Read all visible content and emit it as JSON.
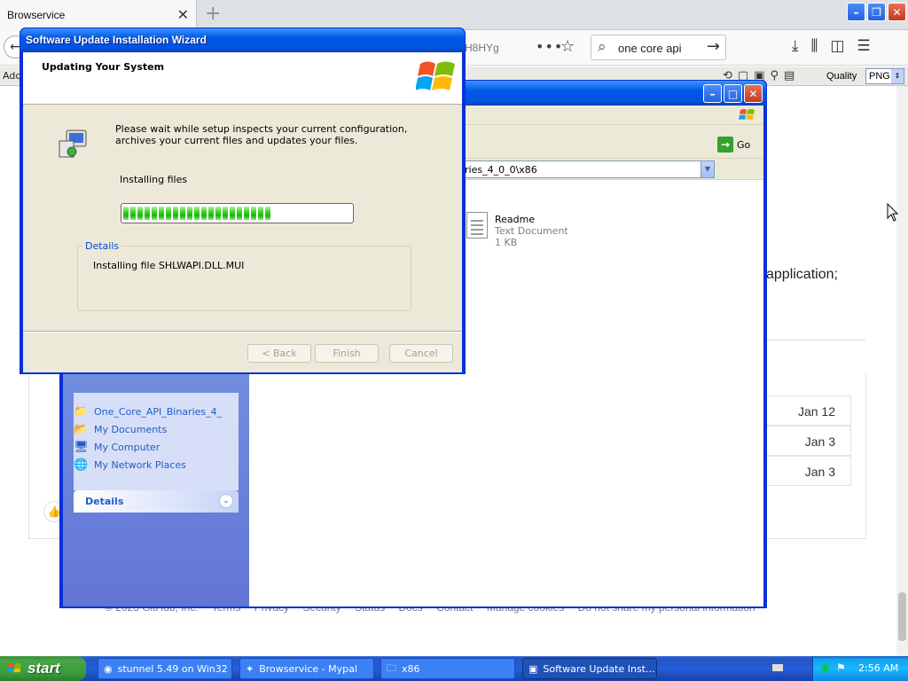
{
  "browser": {
    "tab_title": "Browservice",
    "url_fragment": "H8HYg",
    "search_text": "one core api",
    "addon_label": "Add",
    "quality_label": "Quality",
    "quality_value": "PNG",
    "page_text_fragment": "application;",
    "dates": [
      "Jan 12",
      "Jan 3",
      "Jan 3"
    ],
    "footer_links": [
      "© 2023 GitHub, Inc.",
      "Terms",
      "Privacy",
      "Security",
      "Status",
      "Docs",
      "Contact",
      "Manage cookies",
      "Do not share my personal information"
    ]
  },
  "explorer": {
    "address_value": "ries_4_0_0\\x86",
    "go_label": "Go",
    "other_places": [
      {
        "label": "One_Core_API_Binaries_4_",
        "icon": "folder-icon"
      },
      {
        "label": "My Documents",
        "icon": "documents-icon"
      },
      {
        "label": "My Computer",
        "icon": "computer-icon"
      },
      {
        "label": "My Network Places",
        "icon": "network-icon"
      }
    ],
    "details_label": "Details",
    "file": {
      "name": "Readme",
      "type": "Text Document",
      "size": "1 KB"
    }
  },
  "wizard": {
    "title": "Software Update Installation Wizard",
    "header_title": "Updating Your System",
    "description": "Please wait while setup inspects your current configuration, archives your current files and updates your files.",
    "status": "Installing files",
    "progress_fraction": 0.67,
    "details_label": "Details",
    "detail_text": "Installing file SHLWAPI.DLL.MUI",
    "back_label": "< Back",
    "finish_label": "Finish",
    "cancel_label": "Cancel"
  },
  "taskbar": {
    "start_label": "start",
    "items": [
      {
        "label": "stunnel 5.49 on Win32",
        "icon": "stunnel-icon"
      },
      {
        "label": "Browservice - Mypal",
        "icon": "mypal-icon"
      },
      {
        "label": "x86",
        "icon": "folder-icon"
      },
      {
        "label": "Software Update Inst...",
        "icon": "installer-icon"
      }
    ],
    "clock": "2:56 AM"
  },
  "colors": {
    "xp_blue": "#0054e3",
    "progress_green": "#2fcd1a",
    "start_green": "#3a9b3a"
  }
}
